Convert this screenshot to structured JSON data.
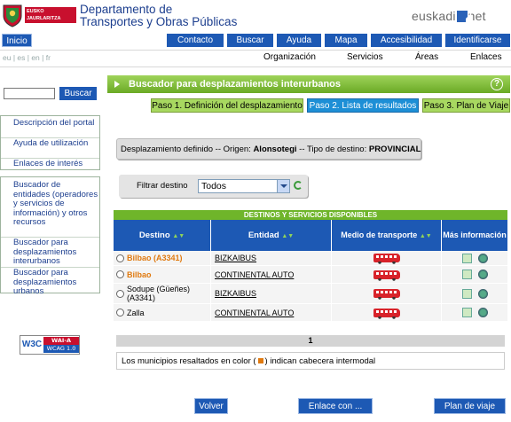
{
  "header": {
    "logo_line1": "EUSKO JAURLARITZA",
    "logo_line2": "GOBIERNO VASCO",
    "title_line1": "Departamento de",
    "title_line2": "Transportes y Obras Públicas",
    "brand_left": "euskadi",
    "brand_right": "net"
  },
  "topnav": {
    "home": "Inicio",
    "items": [
      "Contacto",
      "Buscar",
      "Ayuda",
      "Mapa",
      "Accesibilidad",
      "Identificarse"
    ]
  },
  "languages": [
    "eu",
    "es",
    "en",
    "fr"
  ],
  "subnav": [
    "Organización",
    "Servicios",
    "Áreas",
    "Enlaces"
  ],
  "sidebar": {
    "search_button": "Buscar",
    "group1": [
      "Descripción del portal",
      "Ayuda de utilización",
      "Enlaces de interés"
    ],
    "group2": [
      "Buscador de entidades (operadores y servicios de información) y otros recursos",
      "Buscador para desplazamientos interurbanos",
      "Buscador para desplazamientos urbanos"
    ],
    "badge_w3c": "W3C",
    "badge_level": "WAI-A",
    "badge_wcag": "WCAG 1.0"
  },
  "main": {
    "title": "Buscador para desplazamientos interurbanos",
    "help_icon": "?",
    "steps": [
      "Paso 1. Definición del desplazamiento",
      "Paso 2. Lista de resultados",
      "Paso 3. Plan de Viaje"
    ],
    "summary": {
      "prefix": "Desplazamiento definido -- Origen:",
      "origin": "Alonsotegi",
      "middle": "-- Tipo de destino:",
      "dest_type": "PROVINCIAL"
    },
    "filter": {
      "label": "Filtrar destino",
      "value": "Todos"
    },
    "grid": {
      "caption": "DESTINOS Y SERVICIOS DISPONIBLES",
      "headers": [
        "Destino",
        "Entidad",
        "Medio de transporte",
        "Más información"
      ],
      "rows": [
        {
          "destino": "Bilbao (A3341)",
          "entidad": "BIZKAIBUS",
          "highlight": true
        },
        {
          "destino": "Bilbao",
          "entidad": "CONTINENTAL AUTO",
          "highlight": true
        },
        {
          "destino": "Sodupe (Güeñes) (A3341)",
          "entidad": "BIZKAIBUS",
          "highlight": false
        },
        {
          "destino": "Zalla",
          "entidad": "CONTINENTAL AUTO",
          "highlight": false
        }
      ]
    },
    "pager": "1",
    "note_before": "Los municipios resaltados en color (",
    "note_after": ") indican cabecera intermodal",
    "buttons": [
      "Volver",
      "Enlace con ...",
      "Plan de viaje"
    ]
  },
  "colors": {
    "accent_blue": "#1d59b4",
    "accent_green": "#6fb52a",
    "highlight_orange": "#e07a10",
    "step_active": "#1d8fd6",
    "step_inactive": "#9fd35a"
  }
}
